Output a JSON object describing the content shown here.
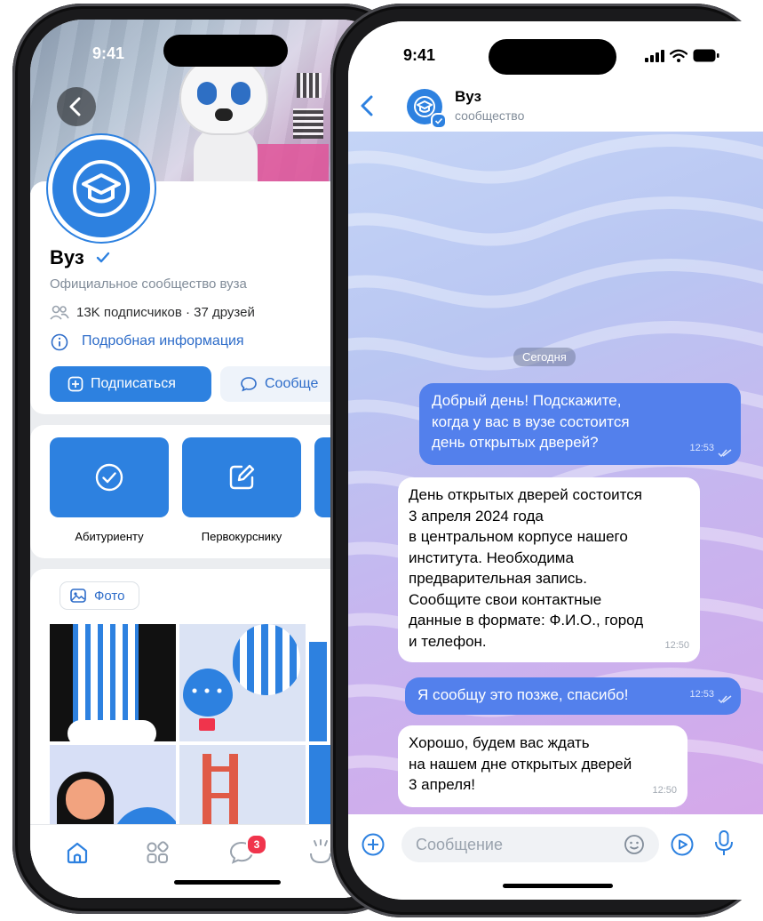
{
  "colors": {
    "accent": "#2d81e0",
    "link": "#2d6cc9",
    "outgoing_bubble": "#5380ec",
    "badge": "#f0344c"
  },
  "left_phone": {
    "status": {
      "time": "9:41"
    },
    "profile": {
      "name": "Вуз",
      "description": "Официальное сообщество вуза",
      "subscribers": "13K подписчиков · 37 друзей",
      "info_link": "Подробная информация",
      "subscribe_label": "Подписаться",
      "message_label": "Сообще"
    },
    "quick_actions": [
      {
        "label": "Абитуриенту",
        "icon": "check-circle-icon"
      },
      {
        "label": "Первокурснику",
        "icon": "edit-square-icon"
      }
    ],
    "photos": {
      "chip_label": "Фото"
    },
    "tabbar": {
      "items": [
        {
          "icon": "home-icon"
        },
        {
          "icon": "services-icon"
        },
        {
          "icon": "messenger-icon",
          "badge": "3"
        },
        {
          "icon": "clips-icon"
        }
      ]
    }
  },
  "right_phone": {
    "status": {
      "time": "9:41"
    },
    "chat": {
      "title": "Вуз",
      "subtitle": "сообщество",
      "date_divider": "Сегодня",
      "messages": [
        {
          "direction": "out",
          "lines": [
            "Добрый день! Подскажите,",
            "когда у вас в вузе состоится",
            "день открытых дверей?"
          ],
          "time": "12:53",
          "read": true
        },
        {
          "direction": "in",
          "lines": [
            "День открытых дверей состоится",
            "3 апреля 2024 года",
            "в центральном корпусе нашего",
            "института. Необходима",
            "предварительная запись.",
            "Сообщите свои контактные",
            "данные в формате: Ф.И.О., город",
            "и телефон."
          ],
          "time": "12:50"
        },
        {
          "direction": "out",
          "lines": [
            "Я сообщу это позже, спасибо!"
          ],
          "time": "12:53",
          "read": true
        },
        {
          "direction": "in",
          "lines": [
            "Хорошо, будем вас ждать",
            "на нашем дне открытых дверей",
            "3 апреля!"
          ],
          "time": "12:50"
        }
      ]
    },
    "input": {
      "placeholder": "Сообщение"
    }
  }
}
